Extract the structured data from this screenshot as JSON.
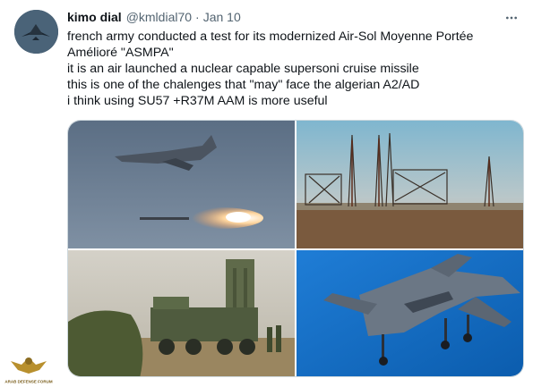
{
  "tweet": {
    "author_name": "kimo dial",
    "author_handle": "@kmldial70",
    "separator": "·",
    "date": "Jan 10",
    "lines": [
      "french army conducted a test for its modernized Air-Sol Moyenne Portée",
      "Amélioré \"ASMPA\"",
      "it is an air launched a nuclear capable supersoni cruise missile",
      "this is one of the chalenges that \"may\" face the algerian A2/AD",
      "i think using SU57 +R37M AAM  is more useful"
    ]
  },
  "icons": {
    "avatar": "jet-avatar",
    "more": "more-icon"
  },
  "media": [
    {
      "subject": "fighter-jet-launching-missile"
    },
    {
      "subject": "radar-towers"
    },
    {
      "subject": "missile-launcher-truck"
    },
    {
      "subject": "su57-fighter-jet"
    }
  ],
  "watermark": {
    "text": "ARAB DEFENSE FORUM"
  },
  "colors": {
    "text": "#0f1419",
    "secondary": "#536471",
    "border": "#cfd9de"
  }
}
